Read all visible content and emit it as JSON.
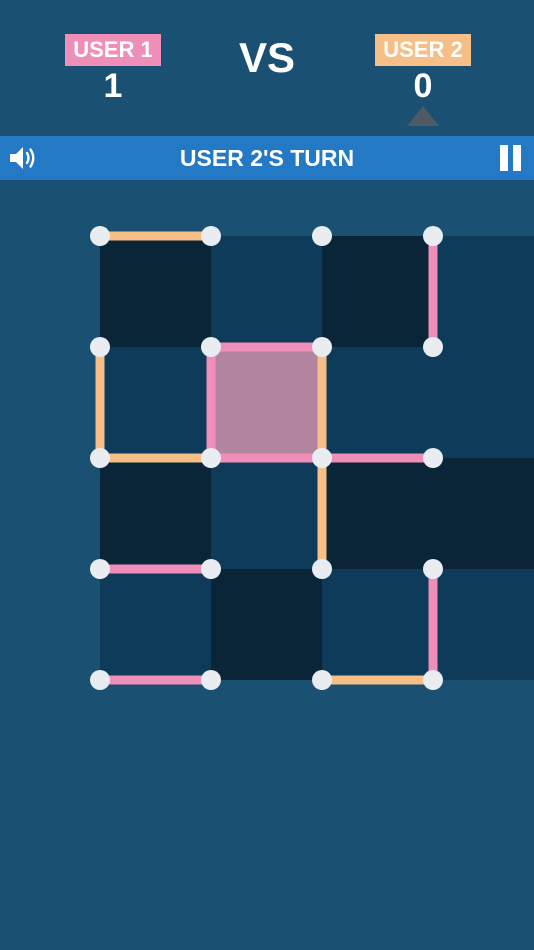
{
  "players": [
    {
      "label": "USER 1",
      "score": "1",
      "color": "#ef8fb9"
    },
    {
      "label": "USER 2",
      "score": "0",
      "color": "#f7bf88"
    }
  ],
  "vs": "VS",
  "turn_text": "USER 2'S TURN",
  "current_player": 2,
  "icons": {
    "sound": "speaker-icon",
    "pause": "pause-icon",
    "turn": "turn-indicator-arrow"
  },
  "colors": {
    "background": "#1a5172",
    "bar": "#2379c3",
    "dot": "#e9edf1",
    "cell_dark": "#0a2537",
    "cell_mid": "#0f3b5a",
    "claimed_user1": "#b3849f"
  },
  "board": {
    "cols": 4,
    "rows": 4,
    "cells": [
      [
        "dark",
        "mid",
        "dark",
        "mid"
      ],
      [
        "mid",
        "user1",
        "mid",
        "mid"
      ],
      [
        "dark",
        "mid",
        "dark",
        "dark"
      ],
      [
        "mid",
        "dark",
        "mid",
        "mid"
      ]
    ],
    "horizontal_lines": [
      {
        "row": 0,
        "col": 0,
        "owner": 2
      },
      {
        "row": 1,
        "col": 1,
        "owner": 1
      },
      {
        "row": 2,
        "col": 0,
        "owner": 2
      },
      {
        "row": 2,
        "col": 1,
        "owner": 1
      },
      {
        "row": 2,
        "col": 2,
        "owner": 1
      },
      {
        "row": 3,
        "col": 0,
        "owner": 1
      },
      {
        "row": 4,
        "col": 0,
        "owner": 1
      },
      {
        "row": 4,
        "col": 2,
        "owner": 2
      }
    ],
    "vertical_lines": [
      {
        "row": 0,
        "col": 3,
        "owner": 1
      },
      {
        "row": 1,
        "col": 0,
        "owner": 2
      },
      {
        "row": 1,
        "col": 1,
        "owner": 1
      },
      {
        "row": 1,
        "col": 2,
        "owner": 2
      },
      {
        "row": 2,
        "col": 2,
        "owner": 2
      },
      {
        "row": 3,
        "col": 3,
        "owner": 1
      }
    ]
  }
}
